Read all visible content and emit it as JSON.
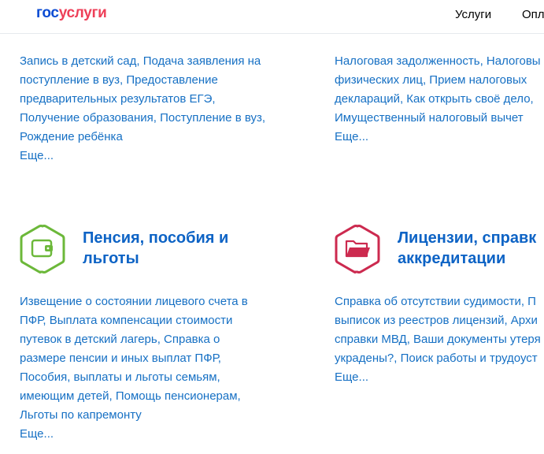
{
  "header": {
    "logo_part1": "гос",
    "logo_part2": "услуги",
    "nav": [
      "Услуги",
      "Опл"
    ]
  },
  "categories_top": [
    {
      "links": "Запись в детский сад, Подача заявления на\nпоступление в вуз, Предоставление\nпредварительных результатов ЕГЭ,\nПолучение образования, Поступление в вуз,\nРождение ребёнка",
      "more": "Еще..."
    },
    {
      "links": "Налоговая задолженность, Налоговы\nфизических лиц, Прием налоговых\nдеклараций, Как открыть своё дело,\nИмущественный налоговый вычет",
      "more": "Еще..."
    }
  ],
  "categories_bottom": [
    {
      "title_line1": "Пенсия, пособия и",
      "title_line2": "льготы",
      "icon": "wallet-icon",
      "icon_color": "#6cb83a",
      "links": "Извещение о состоянии лицевого счета в\nПФР, Выплата компенсации стоимости\nпутевок в детский лагерь, Справка о\nразмере пенсии и иных выплат ПФР,\nПособия, выплаты и льготы семьям,\nимеющим детей, Помощь пенсионерам,\nЛьготы по капремонту",
      "more": "Еще..."
    },
    {
      "title_line1": "Лицензии, справк",
      "title_line2": "аккредитации",
      "icon": "folder-icon",
      "icon_color": "#cc2a4f",
      "links": "Справка об отсутствии судимости, П\nвыписок из реестров лицензий, Архи\nсправки МВД, Ваши документы утеря\nукрадены?, Поиск работы и трудоуст",
      "more": "Еще..."
    }
  ],
  "colors": {
    "link": "#1670c4",
    "title": "#0d63c5",
    "logo_blue": "#0d4cd3",
    "logo_red": "#ee3f58"
  }
}
